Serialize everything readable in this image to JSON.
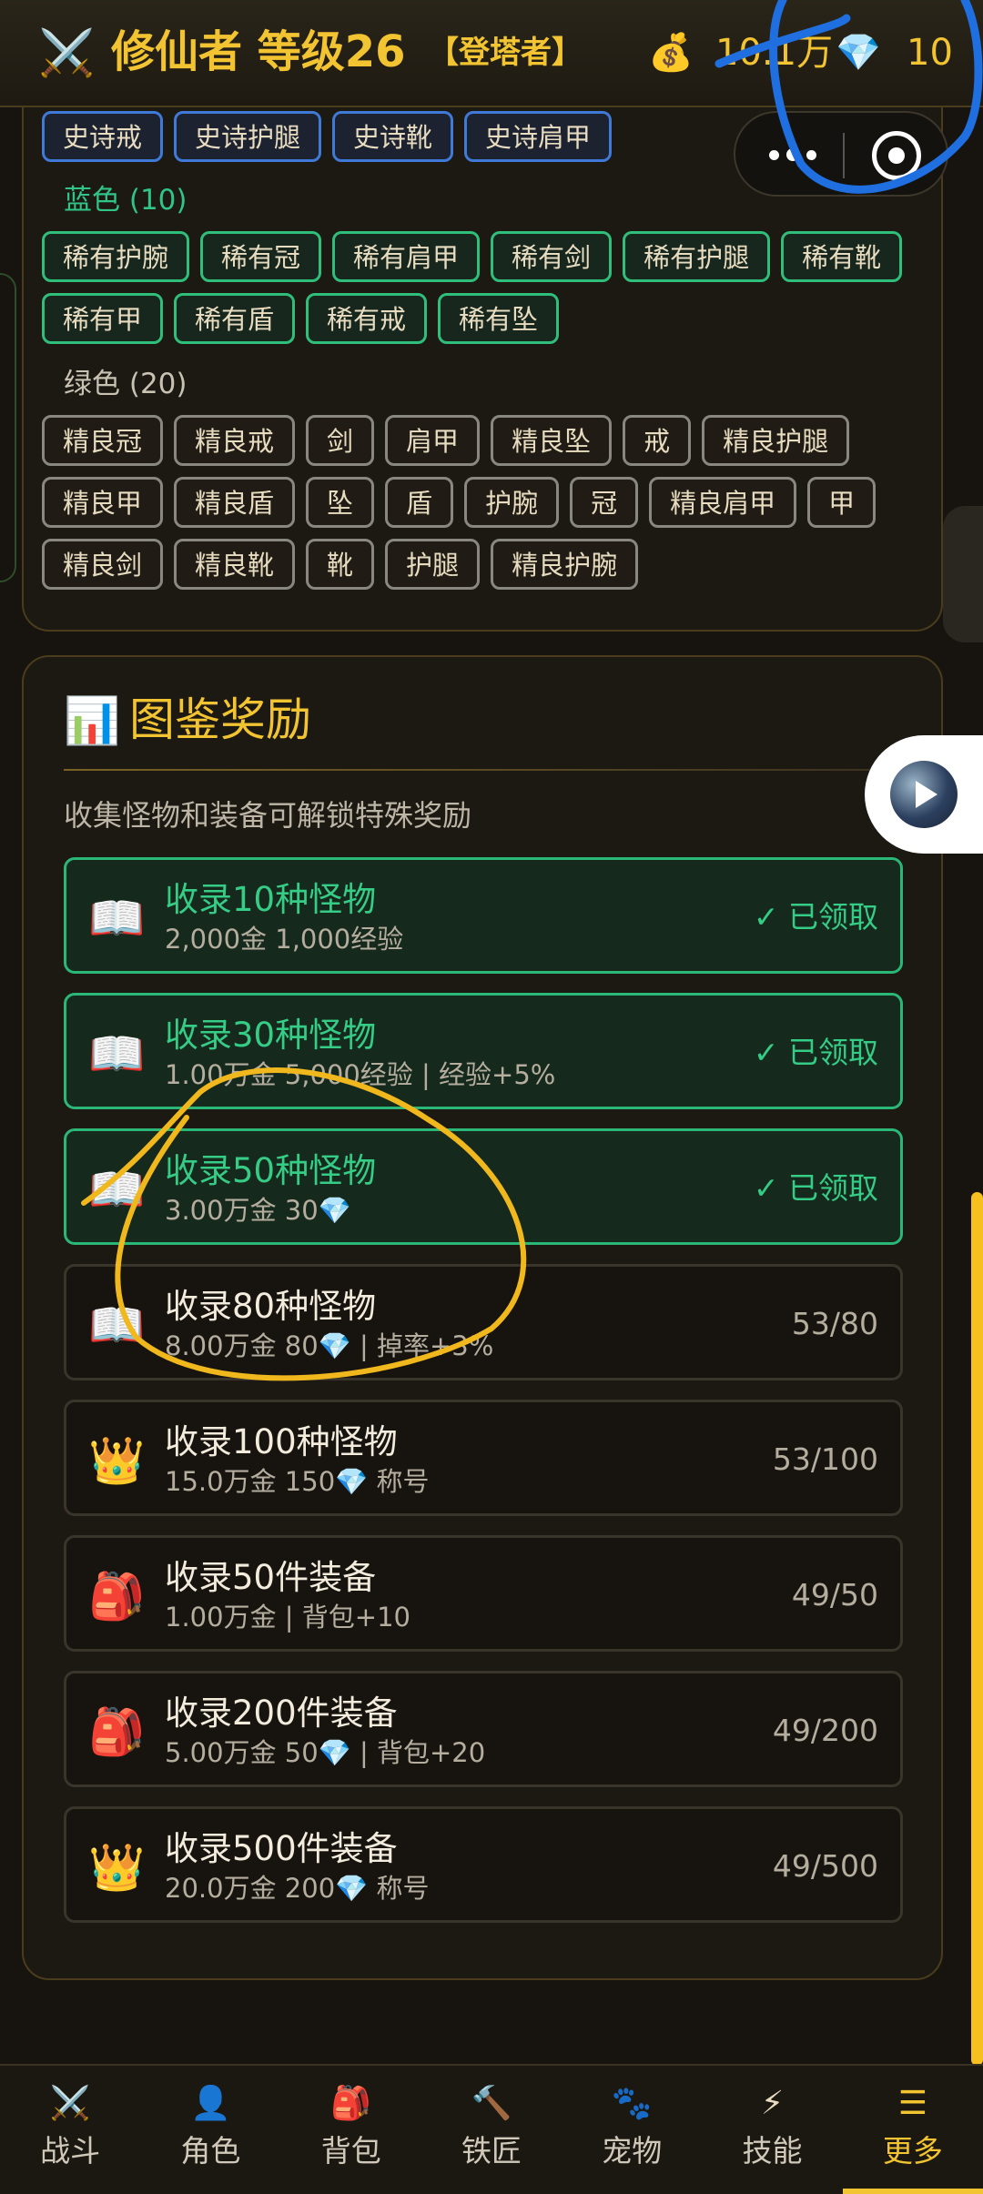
{
  "header": {
    "sword_icon": "crossed-swords-icon",
    "title": "修仙者 等级26",
    "badge": "【登塔者】",
    "gold_icon": "money-bag-icon",
    "gold": "10.1万",
    "gem_icon": "gem-icon",
    "gems": "10"
  },
  "equipment": {
    "purple_row": [
      "史诗戒",
      "史诗护腿",
      "史诗靴",
      "史诗肩甲"
    ],
    "blue_label": "蓝色 (10)",
    "blue_rows": [
      [
        "稀有护腕",
        "稀有冠",
        "稀有肩甲",
        "稀有剑",
        "稀有护腿",
        "稀有靴"
      ],
      [
        "稀有甲",
        "稀有盾",
        "稀有戒",
        "稀有坠"
      ]
    ],
    "green_label": "绿色 (20)",
    "green_rows": [
      [
        "精良冠",
        "精良戒",
        "剑",
        "肩甲",
        "精良坠",
        "戒",
        "精良护腿"
      ],
      [
        "精良甲",
        "精良盾",
        "坠",
        "盾",
        "护腕",
        "冠",
        "精良肩甲",
        "甲"
      ],
      [
        "精良剑",
        "精良靴",
        "靴",
        "护腿",
        "精良护腕"
      ]
    ]
  },
  "rewards": {
    "icon": "bar-chart-icon",
    "title": "图鉴奖励",
    "description": "收集怪物和装备可解锁特殊奖励",
    "items": [
      {
        "icon": "open-book-icon",
        "title": "收录10种怪物",
        "sub": "2,000金 1,000经验",
        "status": "✓ 已领取",
        "claimed": true
      },
      {
        "icon": "open-book-icon",
        "title": "收录30种怪物",
        "sub": "1.00万金 5,000经验 | 经验+5%",
        "status": "✓ 已领取",
        "claimed": true
      },
      {
        "icon": "open-book-icon",
        "title": "收录50种怪物",
        "sub": "3.00万金 30💎",
        "status": "✓ 已领取",
        "claimed": true
      },
      {
        "icon": "open-book-icon",
        "title": "收录80种怪物",
        "sub": "8.00万金 80💎 | 掉率+3%",
        "status": "53/80",
        "claimed": false
      },
      {
        "icon": "crown-icon",
        "title": "收录100种怪物",
        "sub": "15.0万金 150💎 称号",
        "status": "53/100",
        "claimed": false
      },
      {
        "icon": "backpack-icon",
        "title": "收录50件装备",
        "sub": "1.00万金 | 背包+10",
        "status": "49/50",
        "claimed": false
      },
      {
        "icon": "backpack-icon",
        "title": "收录200件装备",
        "sub": "5.00万金 50💎 | 背包+20",
        "status": "49/200",
        "claimed": false
      },
      {
        "icon": "crown-icon",
        "title": "收录500件装备",
        "sub": "20.0万金 200💎 称号",
        "status": "49/500",
        "claimed": false
      }
    ]
  },
  "nav": [
    {
      "icon": "crossed-swords-icon",
      "glyph": "⚔️",
      "label": "战斗"
    },
    {
      "icon": "person-icon",
      "glyph": "👤",
      "label": "角色"
    },
    {
      "icon": "backpack-icon",
      "glyph": "🎒",
      "label": "背包"
    },
    {
      "icon": "hammer-icon",
      "glyph": "🔨",
      "label": "铁匠"
    },
    {
      "icon": "paw-icon",
      "glyph": "🐾",
      "label": "宠物"
    },
    {
      "icon": "lightning-icon",
      "glyph": "⚡",
      "label": "技能"
    },
    {
      "icon": "menu-icon",
      "glyph": "☰",
      "label": "更多",
      "active": true
    }
  ],
  "colors": {
    "accent": "#f2c431",
    "claimed_green": "#35cc86",
    "epic_border": "#3f7ad8",
    "rare_border": "#2fbf7b",
    "annotation_blue": "#1f6fe0",
    "annotation_yellow": "#f0b81c"
  }
}
